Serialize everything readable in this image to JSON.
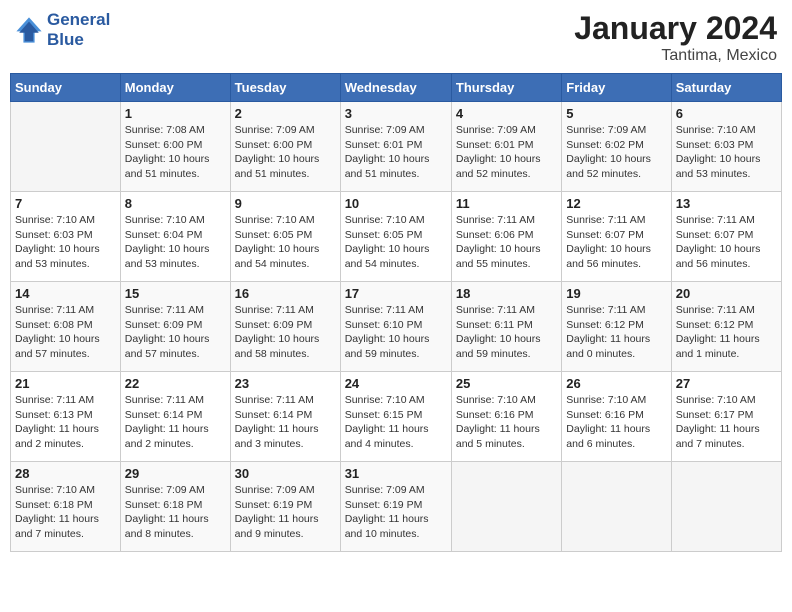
{
  "header": {
    "logo_line1": "General",
    "logo_line2": "Blue",
    "month": "January 2024",
    "location": "Tantima, Mexico"
  },
  "weekdays": [
    "Sunday",
    "Monday",
    "Tuesday",
    "Wednesday",
    "Thursday",
    "Friday",
    "Saturday"
  ],
  "weeks": [
    [
      {
        "day": "",
        "info": ""
      },
      {
        "day": "1",
        "info": "Sunrise: 7:08 AM\nSunset: 6:00 PM\nDaylight: 10 hours\nand 51 minutes."
      },
      {
        "day": "2",
        "info": "Sunrise: 7:09 AM\nSunset: 6:00 PM\nDaylight: 10 hours\nand 51 minutes."
      },
      {
        "day": "3",
        "info": "Sunrise: 7:09 AM\nSunset: 6:01 PM\nDaylight: 10 hours\nand 51 minutes."
      },
      {
        "day": "4",
        "info": "Sunrise: 7:09 AM\nSunset: 6:01 PM\nDaylight: 10 hours\nand 52 minutes."
      },
      {
        "day": "5",
        "info": "Sunrise: 7:09 AM\nSunset: 6:02 PM\nDaylight: 10 hours\nand 52 minutes."
      },
      {
        "day": "6",
        "info": "Sunrise: 7:10 AM\nSunset: 6:03 PM\nDaylight: 10 hours\nand 53 minutes."
      }
    ],
    [
      {
        "day": "7",
        "info": "Sunrise: 7:10 AM\nSunset: 6:03 PM\nDaylight: 10 hours\nand 53 minutes."
      },
      {
        "day": "8",
        "info": "Sunrise: 7:10 AM\nSunset: 6:04 PM\nDaylight: 10 hours\nand 53 minutes."
      },
      {
        "day": "9",
        "info": "Sunrise: 7:10 AM\nSunset: 6:05 PM\nDaylight: 10 hours\nand 54 minutes."
      },
      {
        "day": "10",
        "info": "Sunrise: 7:10 AM\nSunset: 6:05 PM\nDaylight: 10 hours\nand 54 minutes."
      },
      {
        "day": "11",
        "info": "Sunrise: 7:11 AM\nSunset: 6:06 PM\nDaylight: 10 hours\nand 55 minutes."
      },
      {
        "day": "12",
        "info": "Sunrise: 7:11 AM\nSunset: 6:07 PM\nDaylight: 10 hours\nand 56 minutes."
      },
      {
        "day": "13",
        "info": "Sunrise: 7:11 AM\nSunset: 6:07 PM\nDaylight: 10 hours\nand 56 minutes."
      }
    ],
    [
      {
        "day": "14",
        "info": "Sunrise: 7:11 AM\nSunset: 6:08 PM\nDaylight: 10 hours\nand 57 minutes."
      },
      {
        "day": "15",
        "info": "Sunrise: 7:11 AM\nSunset: 6:09 PM\nDaylight: 10 hours\nand 57 minutes."
      },
      {
        "day": "16",
        "info": "Sunrise: 7:11 AM\nSunset: 6:09 PM\nDaylight: 10 hours\nand 58 minutes."
      },
      {
        "day": "17",
        "info": "Sunrise: 7:11 AM\nSunset: 6:10 PM\nDaylight: 10 hours\nand 59 minutes."
      },
      {
        "day": "18",
        "info": "Sunrise: 7:11 AM\nSunset: 6:11 PM\nDaylight: 10 hours\nand 59 minutes."
      },
      {
        "day": "19",
        "info": "Sunrise: 7:11 AM\nSunset: 6:12 PM\nDaylight: 11 hours\nand 0 minutes."
      },
      {
        "day": "20",
        "info": "Sunrise: 7:11 AM\nSunset: 6:12 PM\nDaylight: 11 hours\nand 1 minute."
      }
    ],
    [
      {
        "day": "21",
        "info": "Sunrise: 7:11 AM\nSunset: 6:13 PM\nDaylight: 11 hours\nand 2 minutes."
      },
      {
        "day": "22",
        "info": "Sunrise: 7:11 AM\nSunset: 6:14 PM\nDaylight: 11 hours\nand 2 minutes."
      },
      {
        "day": "23",
        "info": "Sunrise: 7:11 AM\nSunset: 6:14 PM\nDaylight: 11 hours\nand 3 minutes."
      },
      {
        "day": "24",
        "info": "Sunrise: 7:10 AM\nSunset: 6:15 PM\nDaylight: 11 hours\nand 4 minutes."
      },
      {
        "day": "25",
        "info": "Sunrise: 7:10 AM\nSunset: 6:16 PM\nDaylight: 11 hours\nand 5 minutes."
      },
      {
        "day": "26",
        "info": "Sunrise: 7:10 AM\nSunset: 6:16 PM\nDaylight: 11 hours\nand 6 minutes."
      },
      {
        "day": "27",
        "info": "Sunrise: 7:10 AM\nSunset: 6:17 PM\nDaylight: 11 hours\nand 7 minutes."
      }
    ],
    [
      {
        "day": "28",
        "info": "Sunrise: 7:10 AM\nSunset: 6:18 PM\nDaylight: 11 hours\nand 7 minutes."
      },
      {
        "day": "29",
        "info": "Sunrise: 7:09 AM\nSunset: 6:18 PM\nDaylight: 11 hours\nand 8 minutes."
      },
      {
        "day": "30",
        "info": "Sunrise: 7:09 AM\nSunset: 6:19 PM\nDaylight: 11 hours\nand 9 minutes."
      },
      {
        "day": "31",
        "info": "Sunrise: 7:09 AM\nSunset: 6:19 PM\nDaylight: 11 hours\nand 10 minutes."
      },
      {
        "day": "",
        "info": ""
      },
      {
        "day": "",
        "info": ""
      },
      {
        "day": "",
        "info": ""
      }
    ]
  ]
}
